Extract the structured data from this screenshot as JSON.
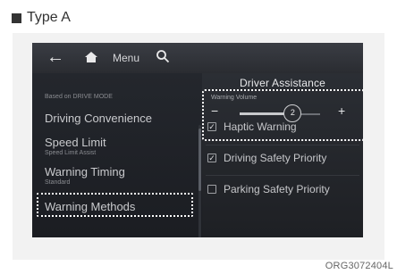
{
  "type_label": "Type A",
  "topbar": {
    "back_icon": "back-arrow-icon",
    "home_icon": "home-icon",
    "menu_label": "Menu",
    "search_icon": "search-icon"
  },
  "left_panel": {
    "mode_label": "Based on DRIVE MODE",
    "items": [
      {
        "label": "Driving Convenience",
        "sub": ""
      },
      {
        "label": "Speed Limit",
        "sub": "Speed Limit Assist"
      },
      {
        "label": "Warning Timing",
        "sub": "Standard"
      },
      {
        "label": "Warning Methods",
        "sub": ""
      }
    ]
  },
  "right_panel": {
    "title": "Driver Assistance",
    "volume": {
      "label": "Warning Volume",
      "value": "2",
      "level": 0.66,
      "minus": "−",
      "plus": "+"
    },
    "options": [
      {
        "label": "Haptic Warning",
        "checked": true
      },
      {
        "label": "Driving Safety Priority",
        "checked": true
      },
      {
        "label": "Parking Safety Priority",
        "checked": false
      }
    ]
  },
  "caption": "ORG3072404L"
}
